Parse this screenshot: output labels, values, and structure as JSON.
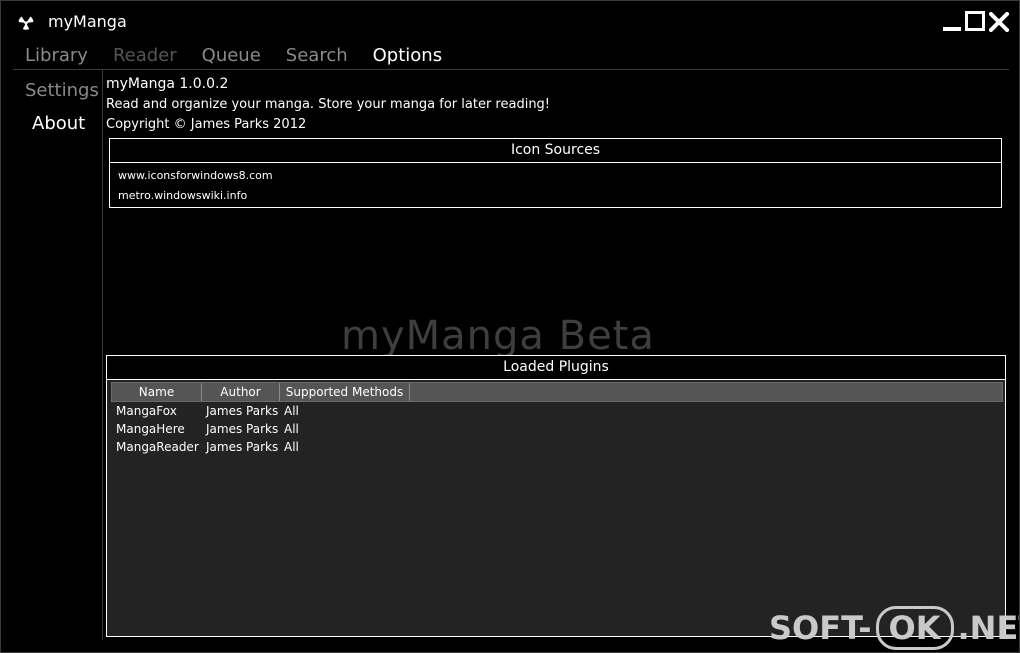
{
  "window": {
    "title": "myManga"
  },
  "nav": {
    "items": [
      {
        "label": "Library",
        "state": "normal"
      },
      {
        "label": "Reader",
        "state": "disabled"
      },
      {
        "label": "Queue",
        "state": "normal"
      },
      {
        "label": "Search",
        "state": "normal"
      },
      {
        "label": "Options",
        "state": "active"
      }
    ]
  },
  "sidebar": {
    "items": [
      {
        "label": "Settings",
        "state": "normal"
      },
      {
        "label": "About",
        "state": "active"
      }
    ]
  },
  "about": {
    "title": "myManga 1.0.0.2",
    "description": "Read and organize your manga. Store your manga for later reading!",
    "copyright": "Copyright © James Parks 2012"
  },
  "icon_sources": {
    "header": "Icon Sources",
    "links": [
      "www.iconsforwindows8.com",
      "metro.windowswiki.info"
    ]
  },
  "watermark": {
    "beta": "myManga Beta",
    "site_left": "SOFT-",
    "site_ok": "OK",
    "site_right": ".NET"
  },
  "plugins": {
    "header": "Loaded Plugins",
    "columns": [
      "Name",
      "Author",
      "Supported Methods"
    ],
    "rows": [
      [
        "MangaFox",
        "James Parks",
        "All"
      ],
      [
        "MangaHere",
        "James Parks",
        "All"
      ],
      [
        "MangaReader",
        "James Parks",
        "All"
      ]
    ]
  },
  "colors": {
    "background": "#000000",
    "grid_background": "#232323",
    "inactive_text": "#8a8a8a",
    "disabled_text": "#555555"
  },
  "icons": {
    "app": "radiation-icon",
    "minimize": "minimize-icon",
    "maximize": "maximize-icon",
    "close": "close-icon"
  }
}
